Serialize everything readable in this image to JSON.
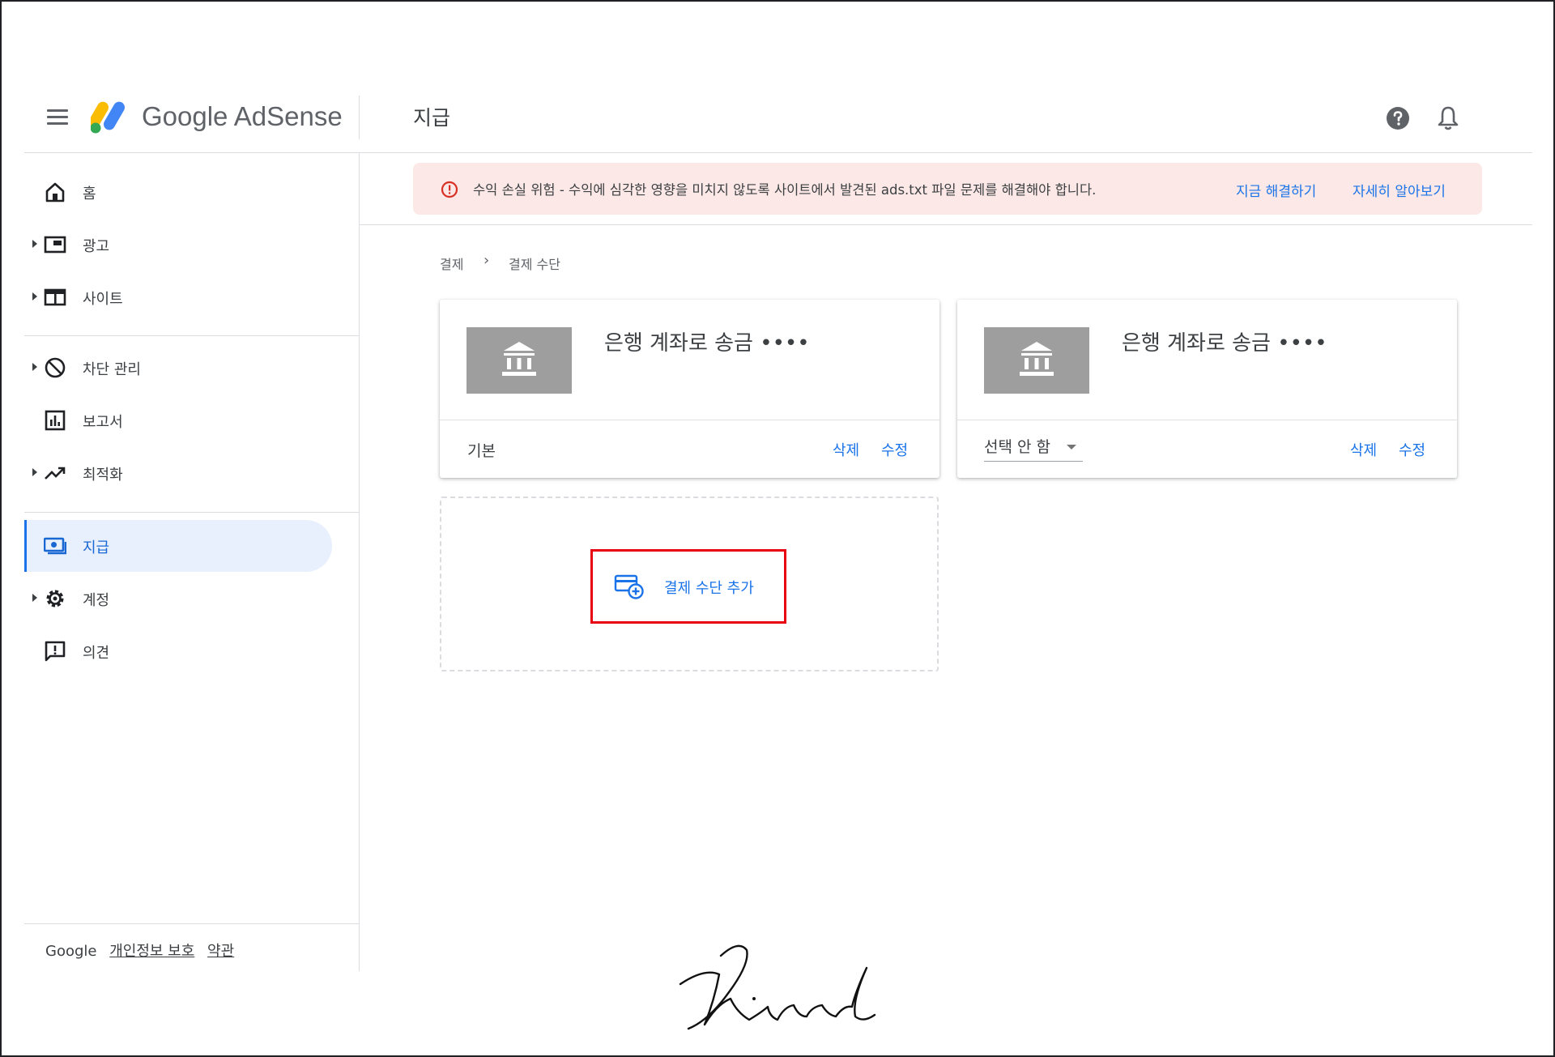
{
  "header": {
    "brand": "Google AdSense",
    "page_title": "지급"
  },
  "sidebar": {
    "items": [
      {
        "label": "홈",
        "icon": "home-icon"
      },
      {
        "label": "광고",
        "icon": "ads-icon"
      },
      {
        "label": "사이트",
        "icon": "sites-icon"
      },
      {
        "label": "차단 관리",
        "icon": "block-icon"
      },
      {
        "label": "보고서",
        "icon": "reports-icon"
      },
      {
        "label": "최적화",
        "icon": "optimization-icon"
      },
      {
        "label": "지급",
        "icon": "payments-icon",
        "active": true
      },
      {
        "label": "계정",
        "icon": "settings-icon"
      },
      {
        "label": "의견",
        "icon": "feedback-icon"
      }
    ],
    "footer": {
      "google": "Google",
      "privacy": "개인정보 보호",
      "terms": "약관"
    }
  },
  "banner": {
    "message": "수익 손실 위험 - 수익에 심각한 영향을 미치지 않도록 사이트에서 발견된 ads.txt 파일 문제를 해결해야 합니다.",
    "fix_link": "지금 해결하기",
    "learn_link": "자세히 알아보기",
    "color": "#fce8e6"
  },
  "breadcrumb": {
    "root": "결제",
    "separator": "›",
    "current": "결제 수단"
  },
  "cards": [
    {
      "title": "은행 계좌로 송금 ••••",
      "status": "기본",
      "delete": "삭제",
      "edit": "수정"
    },
    {
      "title": "은행 계좌로 송금 ••••",
      "select_value": "선택 안 함",
      "delete": "삭제",
      "edit": "수정"
    }
  ],
  "add_payment": {
    "label": "결제 수단 추가",
    "highlight_color": "#e60012"
  },
  "colors": {
    "accent": "#1a73e8",
    "active_bg": "#e8f0fe"
  }
}
